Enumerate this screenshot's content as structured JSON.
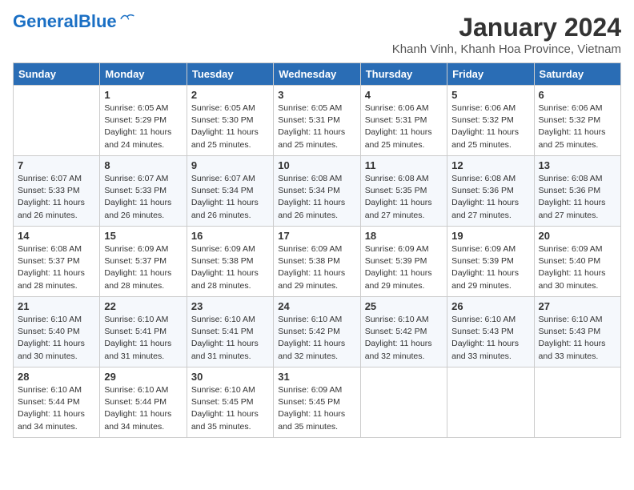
{
  "header": {
    "logo_general": "General",
    "logo_blue": "Blue",
    "month_title": "January 2024",
    "location": "Khanh Vinh, Khanh Hoa Province, Vietnam"
  },
  "days_of_week": [
    "Sunday",
    "Monday",
    "Tuesday",
    "Wednesday",
    "Thursday",
    "Friday",
    "Saturday"
  ],
  "weeks": [
    [
      {
        "day": "",
        "content": ""
      },
      {
        "day": "1",
        "content": "Sunrise: 6:05 AM\nSunset: 5:29 PM\nDaylight: 11 hours\nand 24 minutes."
      },
      {
        "day": "2",
        "content": "Sunrise: 6:05 AM\nSunset: 5:30 PM\nDaylight: 11 hours\nand 25 minutes."
      },
      {
        "day": "3",
        "content": "Sunrise: 6:05 AM\nSunset: 5:31 PM\nDaylight: 11 hours\nand 25 minutes."
      },
      {
        "day": "4",
        "content": "Sunrise: 6:06 AM\nSunset: 5:31 PM\nDaylight: 11 hours\nand 25 minutes."
      },
      {
        "day": "5",
        "content": "Sunrise: 6:06 AM\nSunset: 5:32 PM\nDaylight: 11 hours\nand 25 minutes."
      },
      {
        "day": "6",
        "content": "Sunrise: 6:06 AM\nSunset: 5:32 PM\nDaylight: 11 hours\nand 25 minutes."
      }
    ],
    [
      {
        "day": "7",
        "content": "Sunrise: 6:07 AM\nSunset: 5:33 PM\nDaylight: 11 hours\nand 26 minutes."
      },
      {
        "day": "8",
        "content": "Sunrise: 6:07 AM\nSunset: 5:33 PM\nDaylight: 11 hours\nand 26 minutes."
      },
      {
        "day": "9",
        "content": "Sunrise: 6:07 AM\nSunset: 5:34 PM\nDaylight: 11 hours\nand 26 minutes."
      },
      {
        "day": "10",
        "content": "Sunrise: 6:08 AM\nSunset: 5:34 PM\nDaylight: 11 hours\nand 26 minutes."
      },
      {
        "day": "11",
        "content": "Sunrise: 6:08 AM\nSunset: 5:35 PM\nDaylight: 11 hours\nand 27 minutes."
      },
      {
        "day": "12",
        "content": "Sunrise: 6:08 AM\nSunset: 5:36 PM\nDaylight: 11 hours\nand 27 minutes."
      },
      {
        "day": "13",
        "content": "Sunrise: 6:08 AM\nSunset: 5:36 PM\nDaylight: 11 hours\nand 27 minutes."
      }
    ],
    [
      {
        "day": "14",
        "content": "Sunrise: 6:08 AM\nSunset: 5:37 PM\nDaylight: 11 hours\nand 28 minutes."
      },
      {
        "day": "15",
        "content": "Sunrise: 6:09 AM\nSunset: 5:37 PM\nDaylight: 11 hours\nand 28 minutes."
      },
      {
        "day": "16",
        "content": "Sunrise: 6:09 AM\nSunset: 5:38 PM\nDaylight: 11 hours\nand 28 minutes."
      },
      {
        "day": "17",
        "content": "Sunrise: 6:09 AM\nSunset: 5:38 PM\nDaylight: 11 hours\nand 29 minutes."
      },
      {
        "day": "18",
        "content": "Sunrise: 6:09 AM\nSunset: 5:39 PM\nDaylight: 11 hours\nand 29 minutes."
      },
      {
        "day": "19",
        "content": "Sunrise: 6:09 AM\nSunset: 5:39 PM\nDaylight: 11 hours\nand 29 minutes."
      },
      {
        "day": "20",
        "content": "Sunrise: 6:09 AM\nSunset: 5:40 PM\nDaylight: 11 hours\nand 30 minutes."
      }
    ],
    [
      {
        "day": "21",
        "content": "Sunrise: 6:10 AM\nSunset: 5:40 PM\nDaylight: 11 hours\nand 30 minutes."
      },
      {
        "day": "22",
        "content": "Sunrise: 6:10 AM\nSunset: 5:41 PM\nDaylight: 11 hours\nand 31 minutes."
      },
      {
        "day": "23",
        "content": "Sunrise: 6:10 AM\nSunset: 5:41 PM\nDaylight: 11 hours\nand 31 minutes."
      },
      {
        "day": "24",
        "content": "Sunrise: 6:10 AM\nSunset: 5:42 PM\nDaylight: 11 hours\nand 32 minutes."
      },
      {
        "day": "25",
        "content": "Sunrise: 6:10 AM\nSunset: 5:42 PM\nDaylight: 11 hours\nand 32 minutes."
      },
      {
        "day": "26",
        "content": "Sunrise: 6:10 AM\nSunset: 5:43 PM\nDaylight: 11 hours\nand 33 minutes."
      },
      {
        "day": "27",
        "content": "Sunrise: 6:10 AM\nSunset: 5:43 PM\nDaylight: 11 hours\nand 33 minutes."
      }
    ],
    [
      {
        "day": "28",
        "content": "Sunrise: 6:10 AM\nSunset: 5:44 PM\nDaylight: 11 hours\nand 34 minutes."
      },
      {
        "day": "29",
        "content": "Sunrise: 6:10 AM\nSunset: 5:44 PM\nDaylight: 11 hours\nand 34 minutes."
      },
      {
        "day": "30",
        "content": "Sunrise: 6:10 AM\nSunset: 5:45 PM\nDaylight: 11 hours\nand 35 minutes."
      },
      {
        "day": "31",
        "content": "Sunrise: 6:09 AM\nSunset: 5:45 PM\nDaylight: 11 hours\nand 35 minutes."
      },
      {
        "day": "",
        "content": ""
      },
      {
        "day": "",
        "content": ""
      },
      {
        "day": "",
        "content": ""
      }
    ]
  ]
}
